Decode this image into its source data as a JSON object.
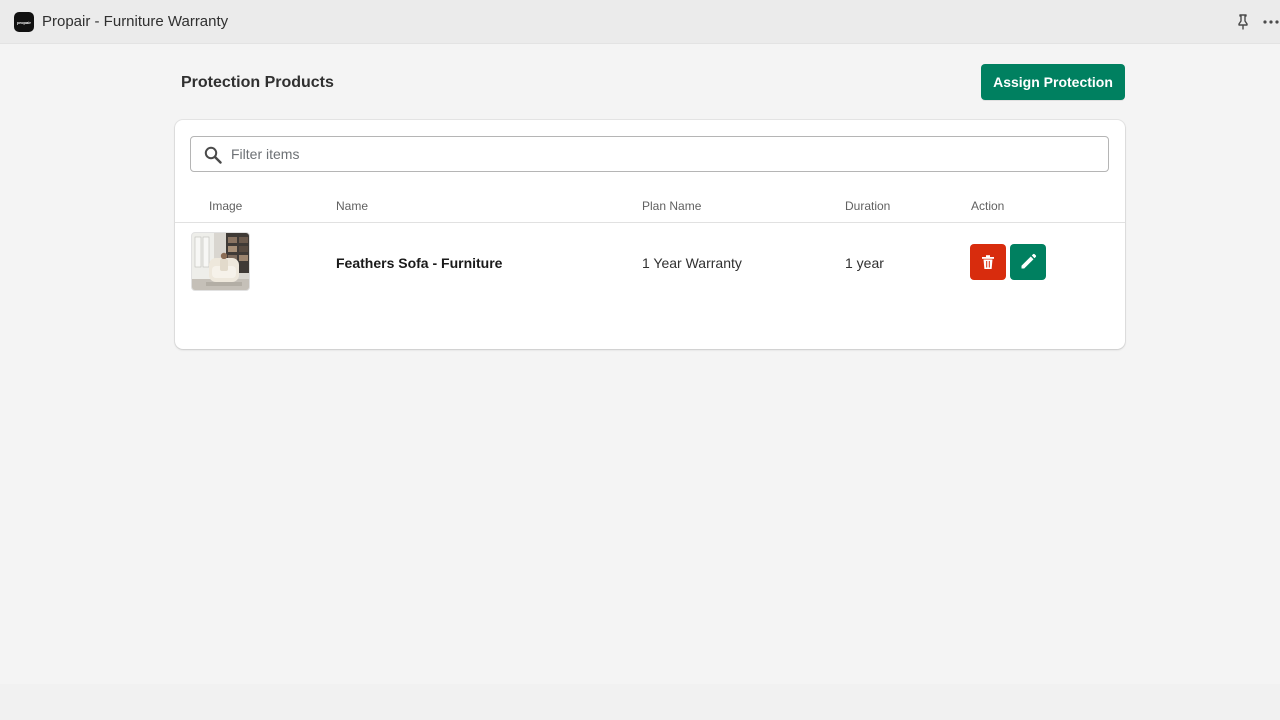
{
  "window": {
    "app_logo_text": "propair",
    "title": "Propair - Furniture Warranty",
    "icons": [
      "pin-icon",
      "more-horizontal-icon"
    ]
  },
  "page": {
    "title": "Protection Products",
    "primary_action_label": "Assign Protection"
  },
  "search": {
    "placeholder": "Filter items",
    "value": ""
  },
  "table": {
    "columns": [
      "Image",
      "Name",
      "Plan Name",
      "Duration",
      "Action"
    ],
    "rows": [
      {
        "image": "sofa-product-thumbnail",
        "name": "Feathers Sofa - Furniture",
        "plan_name": "1 Year Warranty",
        "duration": "1 year",
        "actions": [
          "delete-icon",
          "edit-icon"
        ]
      }
    ]
  },
  "colors": {
    "primary": "#008060",
    "danger": "#d82c0d",
    "background": "#f4f4f4",
    "card": "#ffffff"
  }
}
